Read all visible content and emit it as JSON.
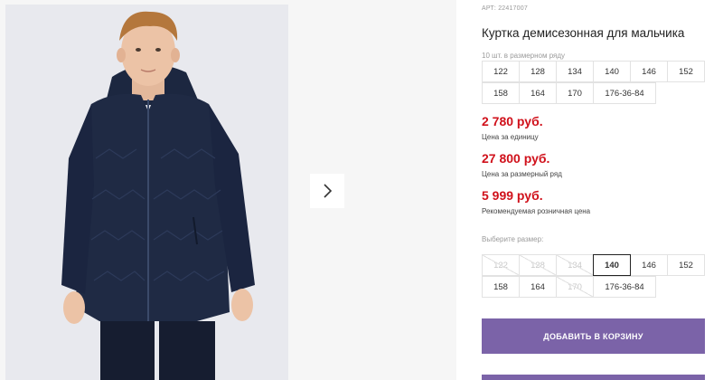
{
  "product": {
    "sku": "АРТ: 22417007",
    "title": "Куртка демисезонная для мальчика",
    "pack_note": "10 шт. в размерном ряду",
    "pack_sizes": [
      [
        "122",
        "128",
        "134",
        "140",
        "146",
        "152"
      ],
      [
        "158",
        "164",
        "170",
        "176-36-84"
      ]
    ],
    "prices": [
      {
        "value": "2 780 руб.",
        "label": "Цена за единицу"
      },
      {
        "value": "27 800 руб.",
        "label": "Цена за размерный ряд"
      },
      {
        "value": "5 999 руб.",
        "label": "Рекомендуемая розничная цена"
      }
    ],
    "choose_size_label": "Выберите размер:",
    "size_options": [
      [
        {
          "label": "122",
          "state": "disabled"
        },
        {
          "label": "128",
          "state": "disabled"
        },
        {
          "label": "134",
          "state": "disabled"
        },
        {
          "label": "140",
          "state": "selected"
        },
        {
          "label": "146",
          "state": "available"
        },
        {
          "label": "152",
          "state": "available"
        }
      ],
      [
        {
          "label": "158",
          "state": "available"
        },
        {
          "label": "164",
          "state": "available"
        },
        {
          "label": "170",
          "state": "disabled"
        },
        {
          "label": "176-36-84",
          "state": "available"
        }
      ]
    ],
    "add_to_cart": "ДОБАВИТЬ В КОРЗИНУ"
  },
  "gallery": {
    "next_icon": "chevron-right-icon"
  },
  "colors": {
    "price": "#d0111b",
    "button": "#7b63a8",
    "jacket": "#1f2a44"
  }
}
